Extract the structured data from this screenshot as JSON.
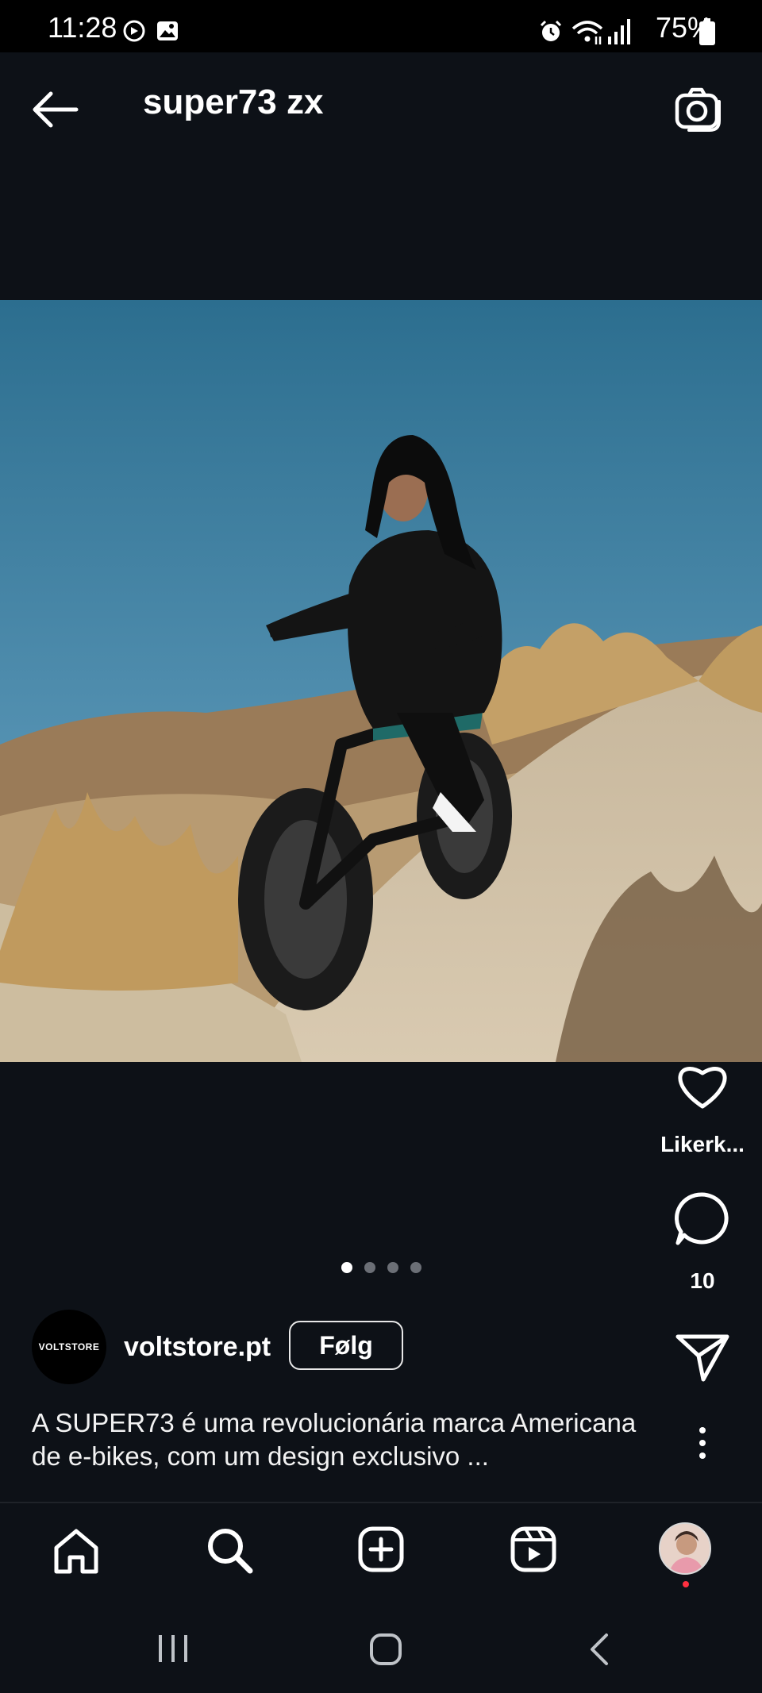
{
  "status_bar": {
    "time": "11:28",
    "battery": "75%",
    "icons": [
      "sync-icon",
      "image-icon",
      "alarm-icon",
      "wifi-icon",
      "signal-icon",
      "battery-icon"
    ]
  },
  "header": {
    "title": "super73 zx",
    "back_icon": "back-arrow-icon",
    "camera_icon": "camera-icon"
  },
  "post": {
    "photo_alt": "Woman riding a black SUPER73 e-bike on a sandy dune path",
    "like_label": "Likerk...",
    "comment_count": "10",
    "carousel": {
      "total": 4,
      "active": 1
    }
  },
  "author": {
    "name": "voltstore.pt",
    "avatar_text": "VOLTSTORE",
    "follow_label": "Følg"
  },
  "caption": {
    "line1": "A SUPER73 é uma revolucionária marca Americana",
    "line2": "de e-bikes, com um design exclusivo ..."
  },
  "nav": {
    "items": [
      "home-icon",
      "search-icon",
      "add-icon",
      "reels-icon",
      "profile-avatar"
    ]
  },
  "colors": {
    "background": "#0d1117",
    "notification_dot": "#ff3040"
  }
}
